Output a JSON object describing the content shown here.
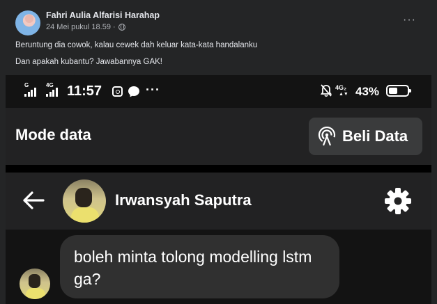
{
  "post": {
    "author": "Fahri Aulia Alfarisi Harahap",
    "date": "24 Mei pukul 18.59 ·",
    "privacy_icon": "globe-icon",
    "more_label": "···",
    "lines": [
      "Beruntung dia cowok, kalau cewek dah keluar kata-kata handalanku",
      "Dan apakah kubantu? Jawabannya GAK!"
    ]
  },
  "statusbar": {
    "signal1_label": "G",
    "signal2_label": "4G",
    "time": "11:57",
    "more_label": "···",
    "network_label": "4G₂",
    "battery_percent": "43%",
    "battery_level": 0.43
  },
  "modebar": {
    "title": "Mode data",
    "buy_label": "Beli Data",
    "buy_icon": "broadcast-icon"
  },
  "chat": {
    "contact_name": "Irwansyah Saputra",
    "settings_icon": "gear-icon",
    "back_icon": "arrow-left-icon",
    "message": "boleh minta tolong modelling lstm ga?"
  },
  "colors": {
    "page_bg": "#242526",
    "screenshot_bg": "#131313",
    "bar_bg": "#222223",
    "button_bg": "#3a3b3c",
    "bubble_bg": "#303030"
  }
}
